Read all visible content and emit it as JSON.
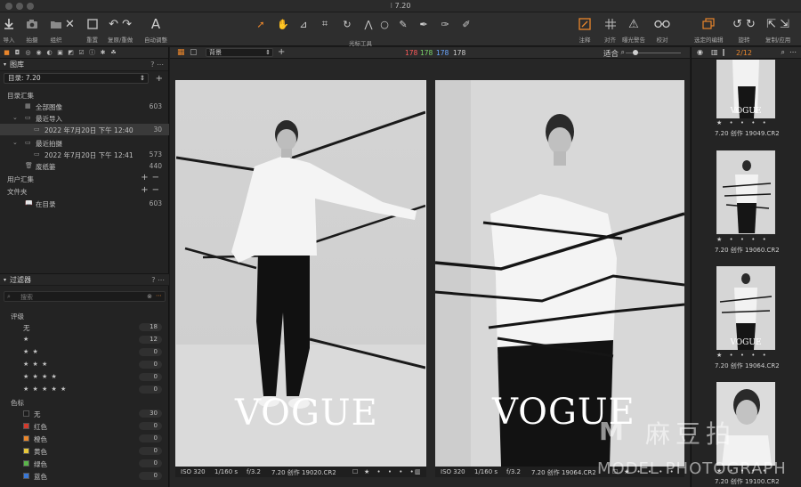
{
  "window": {
    "title": "7.20"
  },
  "toolbar": {
    "left": [
      {
        "label": "导入",
        "icon": "import-icon"
      },
      {
        "label": "拍摄",
        "icon": "camera-icon"
      },
      {
        "label": "组织",
        "icon": "organize-icon"
      },
      {
        "label": "重置",
        "icon": "reset-icon"
      },
      {
        "label": "复原/重做",
        "icon": "undo-redo-icon"
      },
      {
        "label": "自动调整",
        "icon": "auto-adjust-icon"
      }
    ],
    "center_label": "光标工具",
    "right": [
      {
        "label": "注释",
        "icon": "annotate-icon"
      },
      {
        "label": "对齐",
        "icon": "grid-icon"
      },
      {
        "label": "曝光警告",
        "icon": "warning-icon"
      },
      {
        "label": "校对",
        "icon": "glasses-icon"
      },
      {
        "label": "选定的编辑",
        "icon": "layers-icon"
      },
      {
        "label": "旋转",
        "icon": "rotate-icon"
      },
      {
        "label": "复制/应用",
        "icon": "copy-apply-icon"
      }
    ]
  },
  "library": {
    "title": "图库",
    "catalog": "目录: 7.20",
    "catalog_collections": "目录汇集",
    "items": [
      {
        "label": "全部图像",
        "count": "603"
      },
      {
        "label": "最近导入",
        "count": ""
      },
      {
        "label": "2022 年7月20日 下午 12:40",
        "count": "30"
      },
      {
        "label": "最近拍摄",
        "count": ""
      },
      {
        "label": "2022 年7月20日 下午 12:41",
        "count": "573"
      },
      {
        "label": "废纸篓",
        "count": "440"
      }
    ],
    "user_collections": "用户汇集",
    "folders": "文件夹",
    "in_catalog": {
      "label": "在目录",
      "count": "603"
    }
  },
  "filters": {
    "title": "过滤器",
    "search_placeholder": "搜索",
    "rating_title": "评级",
    "ratings": [
      {
        "label": "无",
        "count": "18"
      },
      {
        "label": "★",
        "count": "12"
      },
      {
        "label": "★ ★",
        "count": "0"
      },
      {
        "label": "★ ★ ★",
        "count": "0"
      },
      {
        "label": "★ ★ ★ ★",
        "count": "0"
      },
      {
        "label": "★ ★ ★ ★ ★",
        "count": "0"
      }
    ],
    "color_title": "色标",
    "colors": [
      {
        "label": "无",
        "count": "30",
        "color": "#1e1e1e"
      },
      {
        "label": "红色",
        "count": "0",
        "color": "#d33a2c"
      },
      {
        "label": "橙色",
        "count": "0",
        "color": "#e9862c"
      },
      {
        "label": "黄色",
        "count": "0",
        "color": "#e6c73a"
      },
      {
        "label": "绿色",
        "count": "0",
        "color": "#5ab54a"
      },
      {
        "label": "蓝色",
        "count": "0",
        "color": "#3a78d6"
      }
    ]
  },
  "viewer": {
    "preset": "背景",
    "histogram": {
      "r": "178",
      "g": "178",
      "b": "178",
      "l": "178"
    },
    "histogram_colors": {
      "r": "#ff5a5a",
      "g": "#7ad66a",
      "b": "#6aa6ff",
      "l": "#cfcfcf"
    },
    "fit": "适合",
    "images": [
      {
        "iso": "ISO 320",
        "shutter": "1/160 s",
        "aperture": "f/3.2",
        "name": "7.20 创作 19020.CR2",
        "brand": "VOGUE"
      },
      {
        "iso": "ISO 320",
        "shutter": "1/160 s",
        "aperture": "f/3.2",
        "name": "7.20 创作 19064.CR2",
        "brand": "VOGUE"
      }
    ]
  },
  "browser": {
    "count": "2/12",
    "thumbs": [
      {
        "name": "7.20 创作 19049.CR2",
        "stars": "★ • • • •"
      },
      {
        "name": "7.20 创作 19060.CR2",
        "stars": "★ • • • •"
      },
      {
        "name": "7.20 创作 19064.CR2",
        "stars": "★ • • • •"
      },
      {
        "name": "7.20 创作 19100.CR2",
        "stars": "★ • • • •"
      }
    ]
  },
  "watermark": {
    "top": "麻豆拍",
    "bottom": "MODEL PHOTOGRAPH"
  },
  "accent": "#e9862c"
}
